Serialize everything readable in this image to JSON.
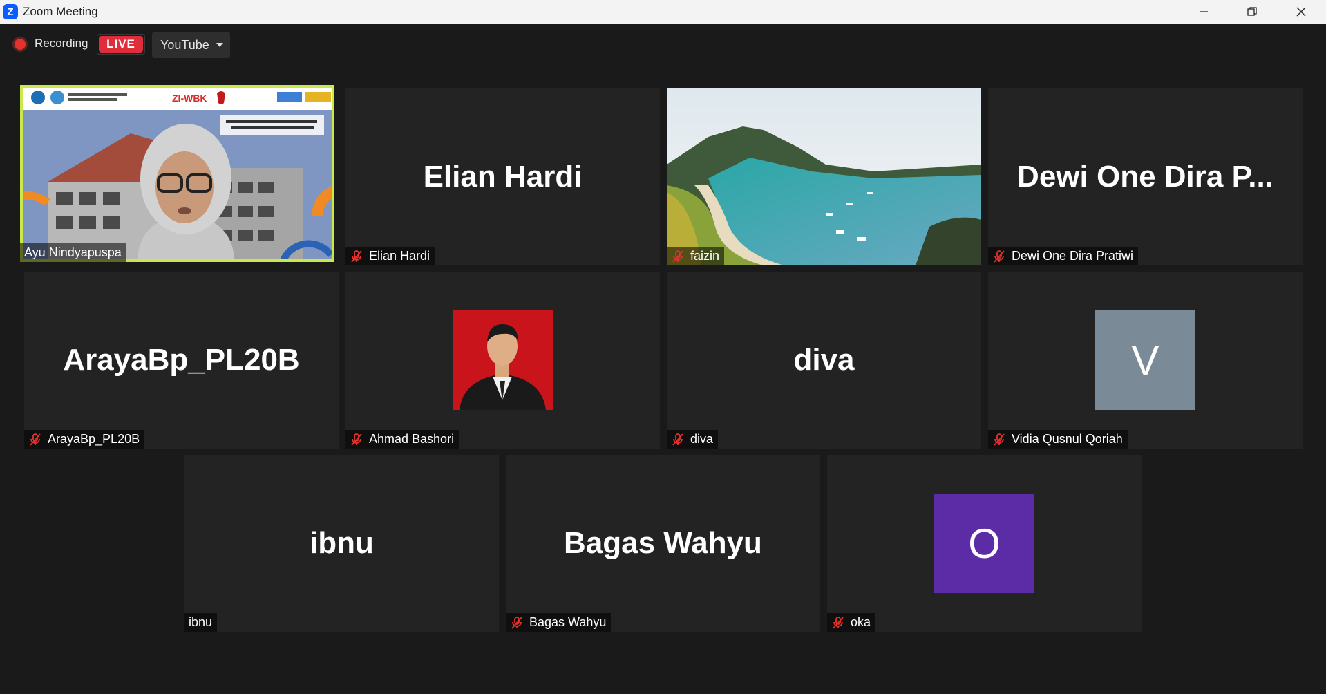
{
  "window": {
    "title": "Zoom Meeting",
    "logo": "Z"
  },
  "toolbar": {
    "recording_label": "Recording",
    "live_label": "LIVE",
    "stream_target": "YouTube"
  },
  "participants": [
    {
      "display_name": "Ayu Nindyapuspa",
      "label": "Ayu Nindyapuspa",
      "muted": false,
      "video": "camera-with-virtual-background",
      "active_speaker": true
    },
    {
      "display_name": "Elian Hardi",
      "label": "Elian Hardi",
      "muted": true,
      "video": "off"
    },
    {
      "display_name": "faizin",
      "label": "faizin",
      "muted": true,
      "video": "landscape-photo"
    },
    {
      "display_name": "Dewi One Dira P...",
      "label": "Dewi One Dira Pratiwi",
      "muted": true,
      "video": "off"
    },
    {
      "display_name": "ArayaBp_PL20B",
      "label": "ArayaBp_PL20B",
      "muted": true,
      "video": "off"
    },
    {
      "display_name": "",
      "label": "Ahmad Bashori",
      "muted": true,
      "video": "profile-photo"
    },
    {
      "display_name": "diva",
      "label": "diva",
      "muted": true,
      "video": "off"
    },
    {
      "display_name": "V",
      "label": "Vidia Qusnul Qoriah",
      "muted": true,
      "video": "avatar-initial",
      "avatar_color": "#7a8a96"
    },
    {
      "display_name": "ibnu",
      "label": "ibnu",
      "muted": false,
      "video": "off"
    },
    {
      "display_name": "Bagas Wahyu",
      "label": "Bagas Wahyu",
      "muted": true,
      "video": "off"
    },
    {
      "display_name": "O",
      "label": "oka",
      "muted": true,
      "video": "avatar-initial",
      "avatar_color": "#5b2ca6"
    }
  ],
  "colors": {
    "live": "#e02d3c",
    "speaker_border": "#c9e84a",
    "mute": "#e5312b",
    "background": "#1a1a1a"
  },
  "icons": [
    "zoom-logo-icon",
    "minimize-icon",
    "restore-icon",
    "close-icon",
    "recording-dot-icon",
    "dropdown-caret-icon",
    "muted-mic-icon"
  ]
}
